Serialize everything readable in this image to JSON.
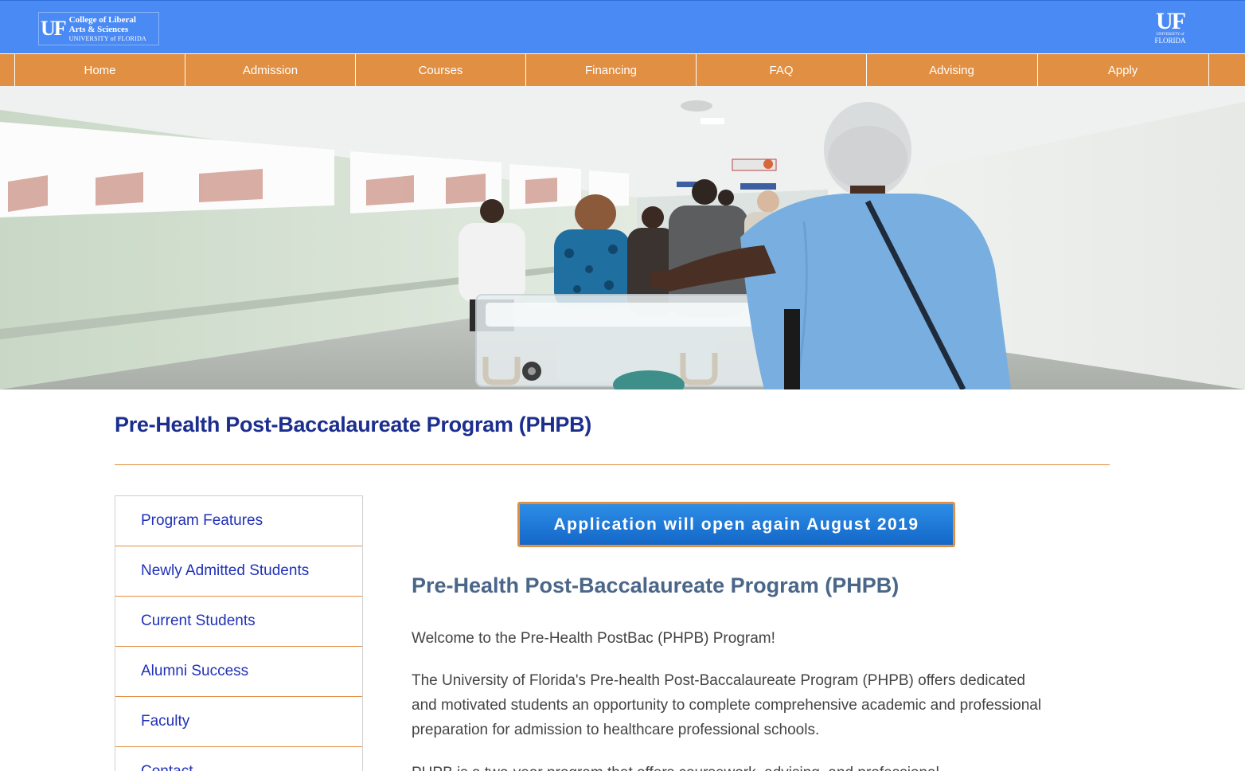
{
  "header": {
    "logo_left": {
      "mark": "UF",
      "line1": "College of Liberal",
      "line2": "Arts & Sciences",
      "line3": "UNIVERSITY of FLORIDA"
    },
    "logo_right": {
      "mark": "UF",
      "line1": "UNIVERSITY of",
      "line2": "FLORIDA"
    }
  },
  "nav": {
    "items": [
      {
        "label": "Home"
      },
      {
        "label": "Admission"
      },
      {
        "label": "Courses"
      },
      {
        "label": "Financing"
      },
      {
        "label": "FAQ"
      },
      {
        "label": "Advising"
      },
      {
        "label": "Apply"
      }
    ]
  },
  "page": {
    "title": "Pre-Health Post-Baccalaureate Program (PHPB)"
  },
  "sidenav": {
    "items": [
      {
        "label": "Program Features"
      },
      {
        "label": "Newly Admitted Students"
      },
      {
        "label": "Current Students"
      },
      {
        "label": "Alumni Success"
      },
      {
        "label": "Faculty"
      },
      {
        "label": "Contact"
      }
    ]
  },
  "main": {
    "apply_button": "Application will open again August 2019",
    "heading": "Pre-Health Post-Baccalaureate Program (PHPB)",
    "welcome": "Welcome to the Pre-Health PostBac (PHPB) Program!",
    "intro": "The University of Florida's Pre-health Post-Baccalaureate Program (PHPB) offers dedicated and motivated students an opportunity to complete comprehensive academic and professional preparation for admission to healthcare professional schools.",
    "next_paragraph": "PHPB is a two-year program that offers coursework, advising, and professional"
  },
  "colors": {
    "header_blue": "#4a8af4",
    "nav_orange": "#e18f42",
    "title_navy": "#1c2e8e",
    "link_blue": "#2031b8",
    "heading_slate": "#4a6688"
  }
}
